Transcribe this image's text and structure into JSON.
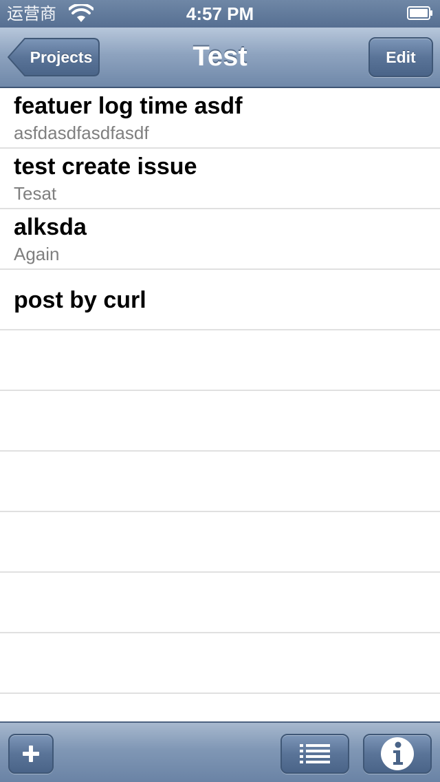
{
  "status_bar": {
    "carrier": "运营商",
    "time": "4:57 PM"
  },
  "nav_bar": {
    "back_label": "Projects",
    "title": "Test",
    "edit_label": "Edit"
  },
  "issues": [
    {
      "title": "featuer log time asdf",
      "subtitle": "asfdasdfasdfasdf"
    },
    {
      "title": "test create issue",
      "subtitle": "Tesat"
    },
    {
      "title": "alksda",
      "subtitle": "Again"
    },
    {
      "title": "post by curl",
      "subtitle": ""
    }
  ],
  "toolbar": {
    "icons": [
      "plus-icon",
      "list-icon",
      "info-icon"
    ]
  },
  "colors": {
    "nav_bar": "#8ea3bf",
    "button": "#5a7498",
    "separator": "#e0e0e0",
    "subtitle": "#7f7f7f"
  }
}
